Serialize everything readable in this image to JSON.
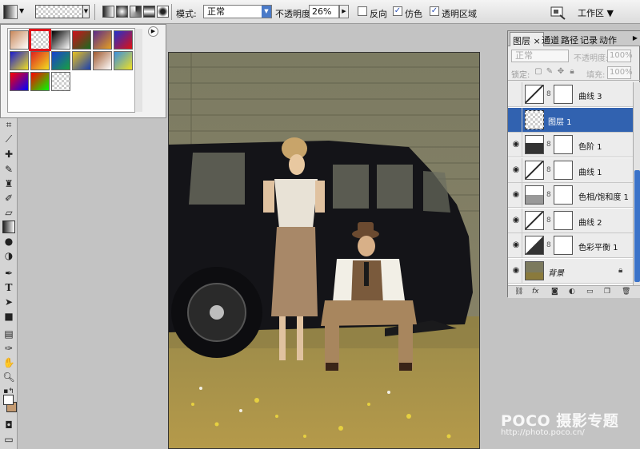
{
  "options": {
    "mode_label": "模式:",
    "mode_value": "正常",
    "opacity_label": "不透明度:",
    "opacity_value": "26%",
    "reverse_label": "反向",
    "reverse_checked": false,
    "dither_label": "仿色",
    "dither_checked": true,
    "transparency_label": "透明区域",
    "transparency_checked": true,
    "workspace_label": "工作区 ▼"
  },
  "gradient_picker": {
    "swatches": [
      [
        "#c9885a",
        "#ffffff"
      ],
      [
        "transparent",
        "transparent"
      ],
      [
        "#000000",
        "#ffffff"
      ],
      [
        "#d0101a",
        "#1a6a20"
      ],
      [
        "#5b2a8a",
        "#e6a020"
      ],
      [
        "#2030d0",
        "#e01010"
      ],
      [
        "#1a1ad0",
        "#f0e020"
      ],
      [
        "#e02020",
        "#f0e020"
      ],
      [
        "#1a40d0",
        "#18a040"
      ],
      [
        "#e8c020",
        "#1a40b0"
      ],
      [
        "#a05a30",
        "#ffffff"
      ],
      [
        "#3a90e0",
        "#f0e020"
      ],
      [
        "#ff0000",
        "#0000ff"
      ],
      [
        "#ff0000",
        "#00ff00"
      ],
      [
        "transparent",
        "transparent"
      ]
    ]
  },
  "layers_panel": {
    "tabs": [
      "图层 ×",
      "通道",
      "路径",
      "记录",
      "动作"
    ],
    "blend_mode": "正常",
    "opacity_label": "不透明度:",
    "opacity_value": "100%",
    "lock_label": "锁定:",
    "fill_label": "填充:",
    "fill_value": "100%",
    "layers": [
      {
        "name": "曲线 3",
        "thumb": "curve",
        "visible": false,
        "selected": false
      },
      {
        "name": "图层 1",
        "thumb": "trans",
        "visible": false,
        "selected": true
      },
      {
        "name": "色阶 1",
        "thumb": "levels",
        "visible": true,
        "selected": false
      },
      {
        "name": "曲线 1",
        "thumb": "curve",
        "visible": true,
        "selected": false
      },
      {
        "name": "色相/饱和度 1",
        "thumb": "hue",
        "visible": true,
        "selected": false
      },
      {
        "name": "曲线 2",
        "thumb": "curve",
        "visible": true,
        "selected": false
      },
      {
        "name": "色彩平衡 1",
        "thumb": "bal",
        "visible": true,
        "selected": false
      },
      {
        "name": "背景",
        "thumb": "photo",
        "visible": true,
        "selected": false
      }
    ]
  },
  "watermark": {
    "brand": "POCO 摄影专题",
    "url": "http://photo.poco.cn/"
  }
}
